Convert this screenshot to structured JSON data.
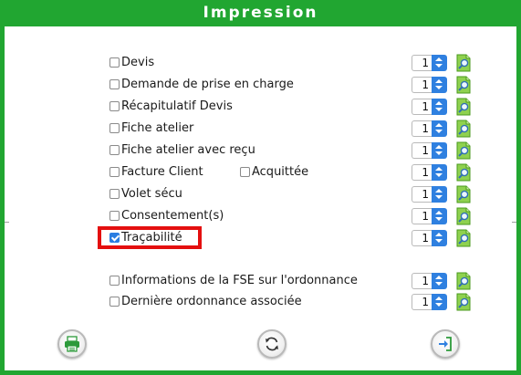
{
  "dialog": {
    "title": "Impression"
  },
  "items": [
    {
      "label": "Devis",
      "checked": false,
      "qty": "1"
    },
    {
      "label": "Demande de prise en charge",
      "checked": false,
      "qty": "1"
    },
    {
      "label": "Récapitulatif Devis",
      "checked": false,
      "qty": "1"
    },
    {
      "label": "Fiche atelier",
      "checked": false,
      "qty": "1"
    },
    {
      "label": "Fiche atelier avec reçu",
      "checked": false,
      "qty": "1"
    },
    {
      "label": "Facture Client",
      "checked": false,
      "qty": "1",
      "extra_label": "Acquittée",
      "extra_checked": false
    },
    {
      "label": "Volet sécu",
      "checked": false,
      "qty": "1"
    },
    {
      "label": "Consentement(s)",
      "checked": false,
      "qty": "1"
    },
    {
      "label": "Traçabilité",
      "checked": true,
      "qty": "1"
    },
    {
      "label": "Informations de la FSE sur l'ordonnance",
      "checked": false,
      "qty": "1"
    },
    {
      "label": "Dernière ordonnance associée",
      "checked": false,
      "qty": "1"
    }
  ],
  "footer": {
    "print_icon": "printer-icon",
    "refresh_icon": "refresh-icon",
    "exit_icon": "exit-icon"
  },
  "colors": {
    "frame": "#21a631",
    "accent_blue": "#2f80e0",
    "highlight": "#e40f0f",
    "preview_green": "#6cbf2a"
  }
}
